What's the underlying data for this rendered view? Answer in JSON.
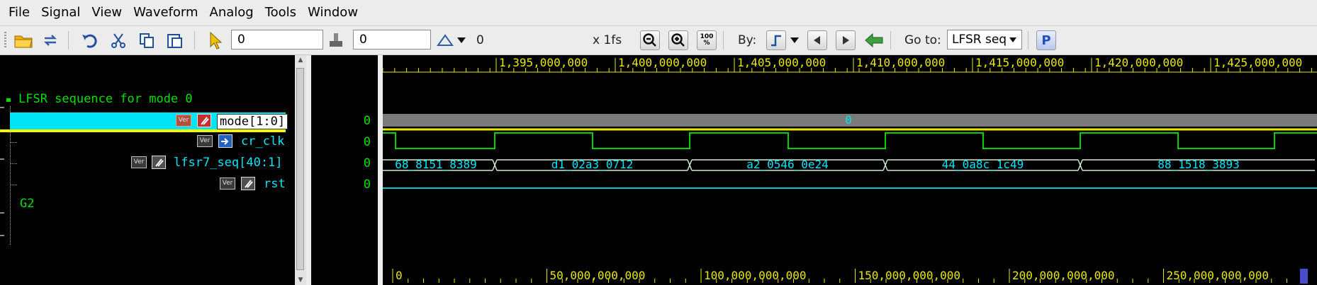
{
  "menu": [
    "File",
    "Signal",
    "View",
    "Waveform",
    "Analog",
    "Tools",
    "Window"
  ],
  "toolbar": {
    "cursor_time": "0",
    "marker_time": "0",
    "delta_value": "0",
    "time_unit": "x 1fs",
    "by_label": "By:",
    "goto_label": "Go to:",
    "goto_value": "LFSR seq",
    "zoom_full_label": "100\n%",
    "p_label": "P"
  },
  "signals": {
    "group_title": "LFSR sequence for mode 0",
    "items": [
      {
        "name": "mode[1:0]",
        "value": "0",
        "selected": true
      },
      {
        "name": "cr_clk",
        "value": "0"
      },
      {
        "name": "lfsr7_seq[40:1]",
        "value": "0"
      },
      {
        "name": "rst",
        "value": "0"
      }
    ],
    "group2": "G2",
    "badge_text": "Ver"
  },
  "ruler_top": {
    "labels": [
      "1,395,000,000",
      "1,400,000,000",
      "1,405,000,000",
      "1,410,000,000",
      "1,415,000,000",
      "1,420,000,000",
      "1,425,000,000"
    ]
  },
  "ruler_bottom": {
    "labels": [
      "0",
      "50,000,000,000",
      "100,000,000,000",
      "150,000,000,000",
      "200,000,000,000",
      "250,000,000,000"
    ]
  },
  "waveforms": {
    "mode_bus_value": "0",
    "lfsr_values": [
      "68_8151_8389",
      "d1_02a3_0712",
      "a2_0546_0e24",
      "44_0a8c_1c49",
      "88_1518_3893"
    ]
  },
  "colors": {
    "selected_row": "#00e5f5",
    "name_text": "#00e5f5",
    "group_text": "#00e000",
    "ruler_text": "#e8e800",
    "clk": "#00d000",
    "bus": "#cfe8d0",
    "rst": "#00c8c8"
  }
}
